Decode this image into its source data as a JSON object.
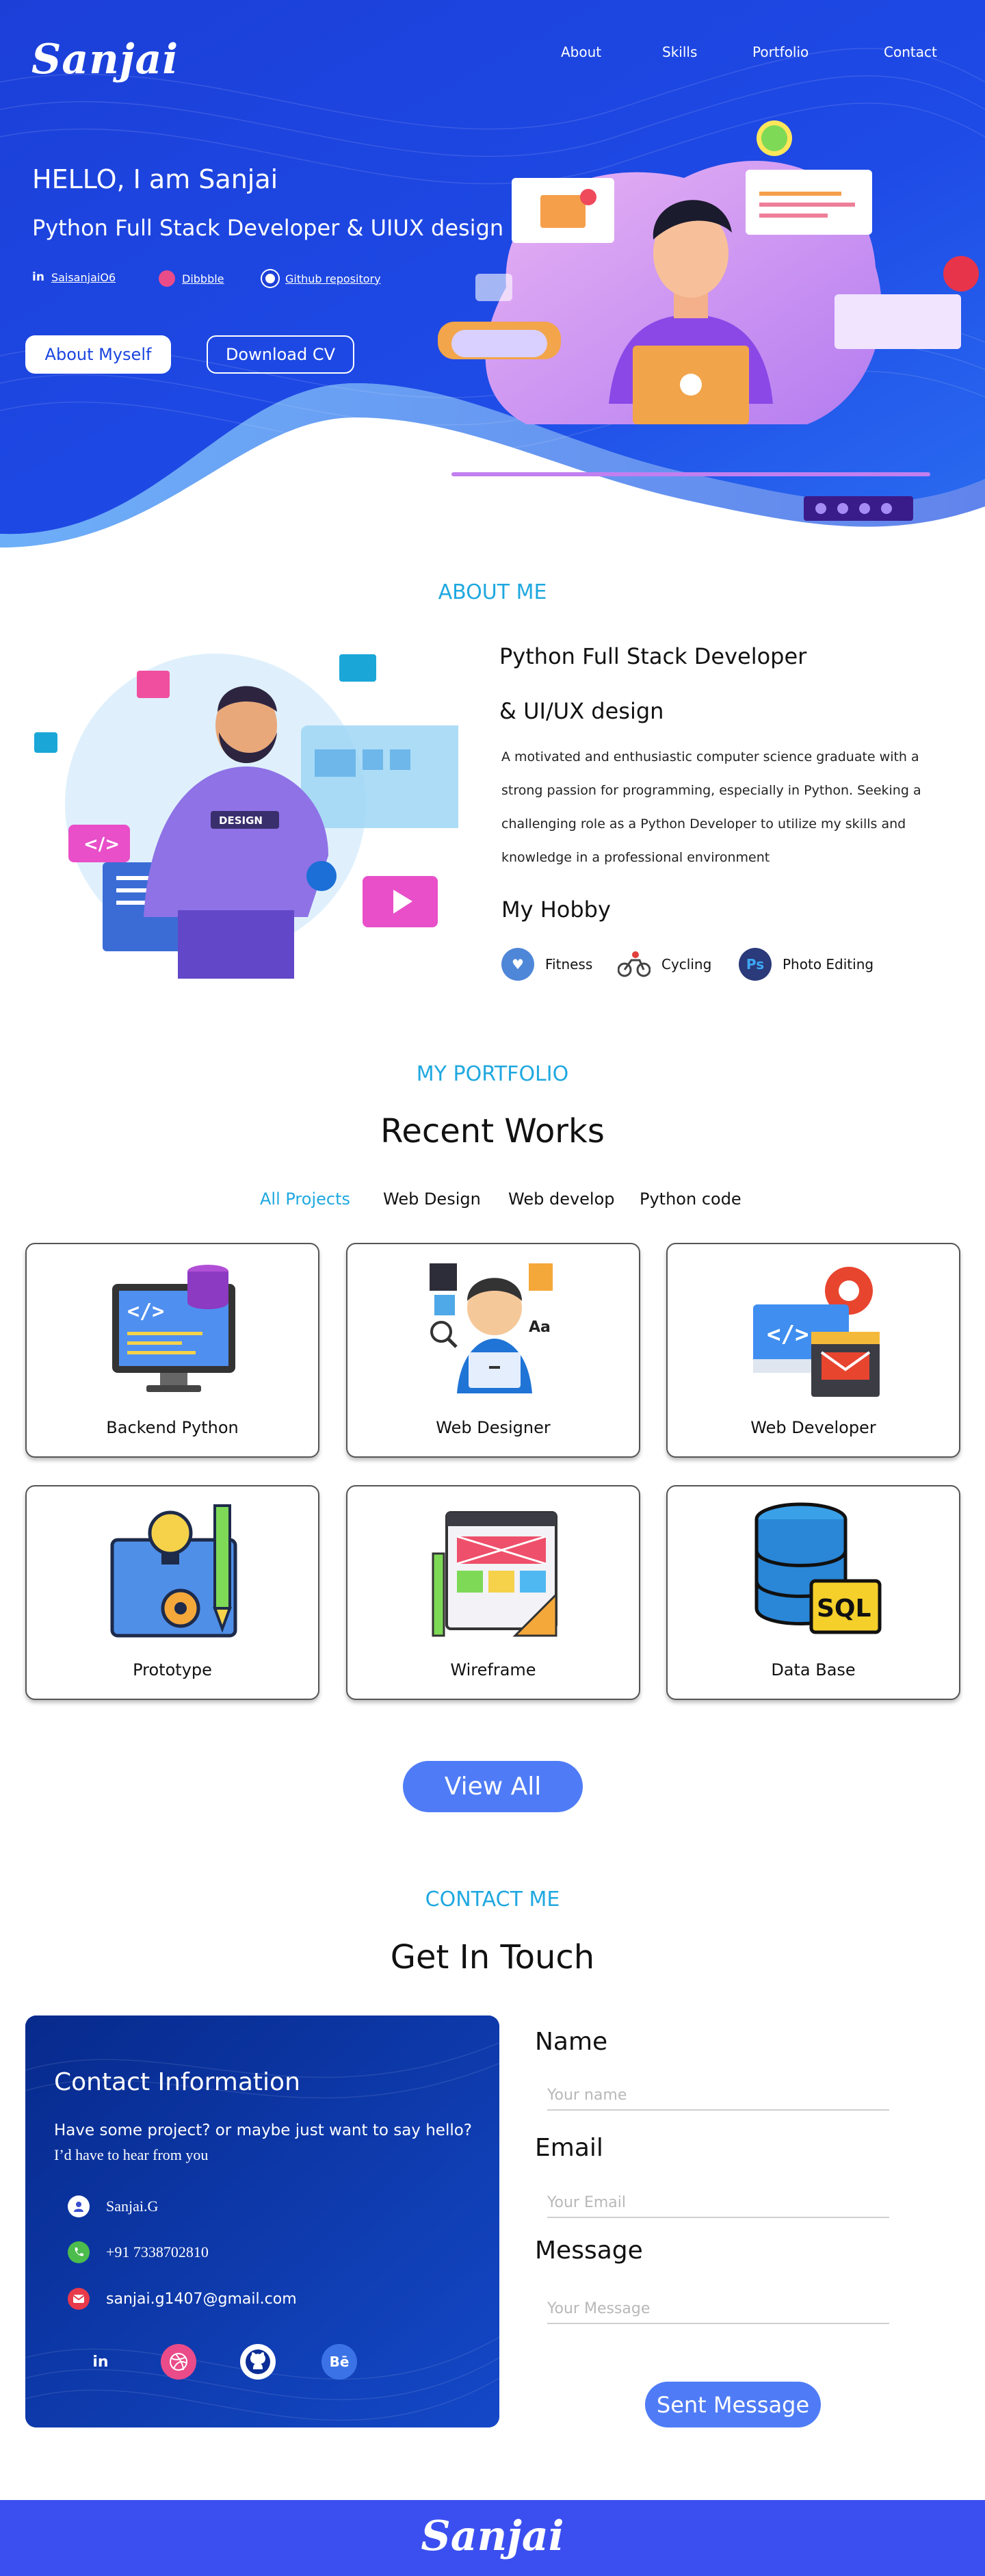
{
  "brand": {
    "logo": "Sanjai"
  },
  "nav": {
    "items": [
      "About",
      "Skills",
      "Portfolio",
      "Contact"
    ]
  },
  "hero": {
    "greeting": "HELLO, I am Sanjai",
    "role": "Python Full Stack Developer & UIUX design",
    "socials": [
      {
        "label": "SaisanjaiO6",
        "icon": "linkedin-icon"
      },
      {
        "label": "Dibbble",
        "icon": "dribbble-icon"
      },
      {
        "label": "Github repository",
        "icon": "github-icon"
      }
    ],
    "about_button": "About Myself",
    "cv_button": "Download CV"
  },
  "about": {
    "label": "ABOUT ME",
    "heading_line1": "Python Full Stack Developer",
    "heading_line2": "& UI/UX design",
    "paragraph": "A motivated and enthusiastic computer science graduate with a strong passion for programming, especially in Python. Seeking a challenging role as a Python Developer to utilize my skills and knowledge in a professional environment",
    "hobby_title": "My Hobby",
    "hobbies": [
      {
        "label": "Fitness",
        "icon": "fitness-icon"
      },
      {
        "label": "Cycling",
        "icon": "cycling-icon"
      },
      {
        "label": "Photo Editing",
        "icon": "photoshop-icon"
      }
    ]
  },
  "portfolio": {
    "label": "MY PORTFOLIO",
    "title": "Recent Works",
    "filters": [
      "All Projects",
      "Web Design",
      "Web develop",
      "Python code"
    ],
    "active_filter": "All Projects",
    "cards": [
      {
        "label": "Backend Python",
        "icon": "backend-python-icon"
      },
      {
        "label": "Web Designer",
        "icon": "web-designer-icon"
      },
      {
        "label": "Web Developer",
        "icon": "web-developer-icon"
      },
      {
        "label": "Prototype",
        "icon": "prototype-icon"
      },
      {
        "label": "Wireframe",
        "icon": "wireframe-icon"
      },
      {
        "label": "Data Base",
        "icon": "database-icon"
      }
    ],
    "view_all": "View All",
    "sql_badge": "SQL"
  },
  "contact": {
    "label": "CONTACT ME",
    "title": "Get In Touch",
    "info_title": "Contact Information",
    "info_sub1": "Have some project? or maybe just want to say hello?",
    "info_sub2": "I’d have to hear from you",
    "name": "Sanjai.G",
    "phone": "+91 7338702810",
    "email": "sanjai.g1407@gmail.com",
    "social_icons": [
      "linkedin-icon",
      "dribbble-icon",
      "github-icon",
      "behance-icon"
    ],
    "form": {
      "name_label": "Name",
      "name_placeholder": "Your name",
      "email_label": "Email",
      "email_placeholder": "Your Email",
      "message_label": "Message",
      "message_placeholder": "Your Message",
      "submit": "Sent Message"
    }
  },
  "footer": {
    "logo": "Sanjai"
  },
  "colors": {
    "hero_blue": "#1a3fe0",
    "accent_cyan": "#1fa8e0",
    "button_blue": "#4f7cf6",
    "footer_blue": "#3b4ff0",
    "contact_navy": "#0b2d95"
  }
}
